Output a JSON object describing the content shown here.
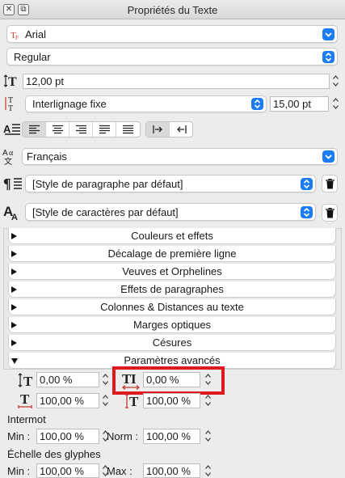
{
  "window": {
    "title": "Propriétés du Texte"
  },
  "font": {
    "family": "Arial",
    "style": "Regular"
  },
  "size": {
    "value": "12,00 pt"
  },
  "leading": {
    "mode": "Interlignage fixe",
    "value": "15,00 pt"
  },
  "alignment": {
    "selected": "left",
    "options": [
      "left",
      "center",
      "right",
      "justify",
      "justify-all"
    ],
    "direction_selected": "ltr"
  },
  "language": {
    "value": "Français"
  },
  "paragraph_style": {
    "value": "[Style de paragraphe par défaut]"
  },
  "character_style": {
    "value": "[Style de caractères par défaut]"
  },
  "sections": [
    {
      "label": "Couleurs et effets",
      "expanded": false
    },
    {
      "label": "Décalage de première ligne",
      "expanded": false
    },
    {
      "label": "Veuves et Orphelines",
      "expanded": false
    },
    {
      "label": "Effets de paragraphes",
      "expanded": false
    },
    {
      "label": "Colonnes & Distances au texte",
      "expanded": false
    },
    {
      "label": "Marges optiques",
      "expanded": false
    },
    {
      "label": "Césures",
      "expanded": false
    },
    {
      "label": "Paramètres avancés",
      "expanded": true
    }
  ],
  "advanced": {
    "baseline_offset": "0,00 %",
    "tracking": "0,00 %",
    "char_width": "100,00 %",
    "char_height": "100,00 %",
    "intermot_label": "Intermot",
    "intermot_min_label": "Min :",
    "intermot_min": "100,00 %",
    "intermot_norm_label": "Norm :",
    "intermot_norm": "100,00 %",
    "glyph_scale_label": "Échelle des glyphes",
    "glyph_min_label": "Min :",
    "glyph_min": "100,00 %",
    "glyph_max_label": "Max :",
    "glyph_max": "100,00 %"
  },
  "colors": {
    "accent": "#1c7cf4",
    "highlight": "#e0191e",
    "icon_red": "#c0392b"
  }
}
